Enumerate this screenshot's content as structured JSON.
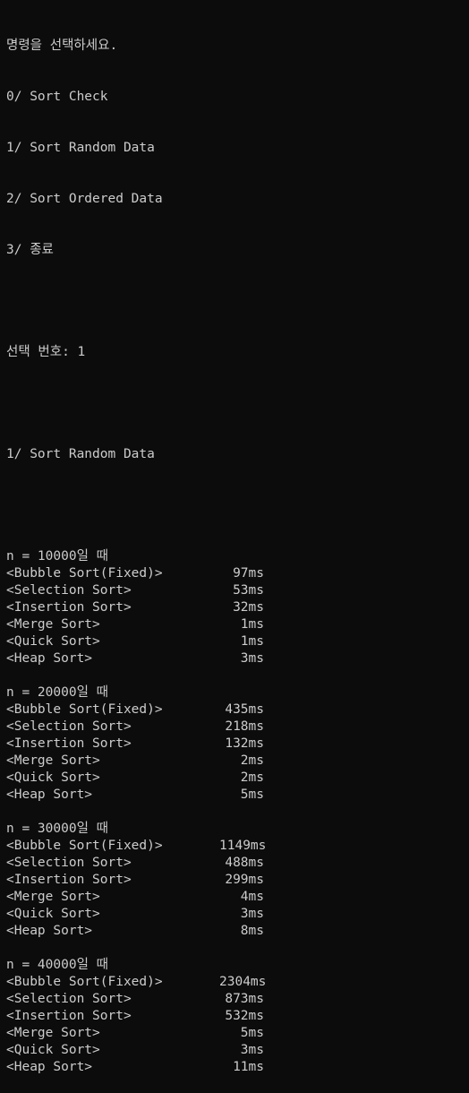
{
  "menu": {
    "prompt": "명령을 선택하세요.",
    "options": [
      "0/ Sort Check",
      "1/ Sort Random Data",
      "2/ Sort Ordered Data",
      "3/ 종료"
    ]
  },
  "selection_line": "선택 번호: 1",
  "selected_echo": "1/ Sort Random Data",
  "runs": [
    {
      "header": "n = 10000일 때",
      "results": [
        {
          "name": "<Bubble Sort(Fixed)>",
          "time": "97ms"
        },
        {
          "name": "<Selection Sort>",
          "time": "53ms"
        },
        {
          "name": "<Insertion Sort>",
          "time": "32ms"
        },
        {
          "name": "<Merge Sort>",
          "time": "1ms"
        },
        {
          "name": "<Quick Sort>",
          "time": "1ms"
        },
        {
          "name": "<Heap Sort>",
          "time": "3ms"
        }
      ]
    },
    {
      "header": "n = 20000일 때",
      "results": [
        {
          "name": "<Bubble Sort(Fixed)>",
          "time": "435ms"
        },
        {
          "name": "<Selection Sort>",
          "time": "218ms"
        },
        {
          "name": "<Insertion Sort>",
          "time": "132ms"
        },
        {
          "name": "<Merge Sort>",
          "time": "2ms"
        },
        {
          "name": "<Quick Sort>",
          "time": "2ms"
        },
        {
          "name": "<Heap Sort>",
          "time": "5ms"
        }
      ]
    },
    {
      "header": "n = 30000일 때",
      "results": [
        {
          "name": "<Bubble Sort(Fixed)>",
          "time": "1149ms"
        },
        {
          "name": "<Selection Sort>",
          "time": "488ms"
        },
        {
          "name": "<Insertion Sort>",
          "time": "299ms"
        },
        {
          "name": "<Merge Sort>",
          "time": "4ms"
        },
        {
          "name": "<Quick Sort>",
          "time": "3ms"
        },
        {
          "name": "<Heap Sort>",
          "time": "8ms"
        }
      ]
    },
    {
      "header": "n = 40000일 때",
      "results": [
        {
          "name": "<Bubble Sort(Fixed)>",
          "time": "2304ms"
        },
        {
          "name": "<Selection Sort>",
          "time": "873ms"
        },
        {
          "name": "<Insertion Sort>",
          "time": "532ms"
        },
        {
          "name": "<Merge Sort>",
          "time": "5ms"
        },
        {
          "name": "<Quick Sort>",
          "time": "3ms"
        },
        {
          "name": "<Heap Sort>",
          "time": "11ms"
        }
      ]
    }
  ],
  "colors": {
    "background": "#0c0c0c",
    "text": "#cccccc"
  }
}
